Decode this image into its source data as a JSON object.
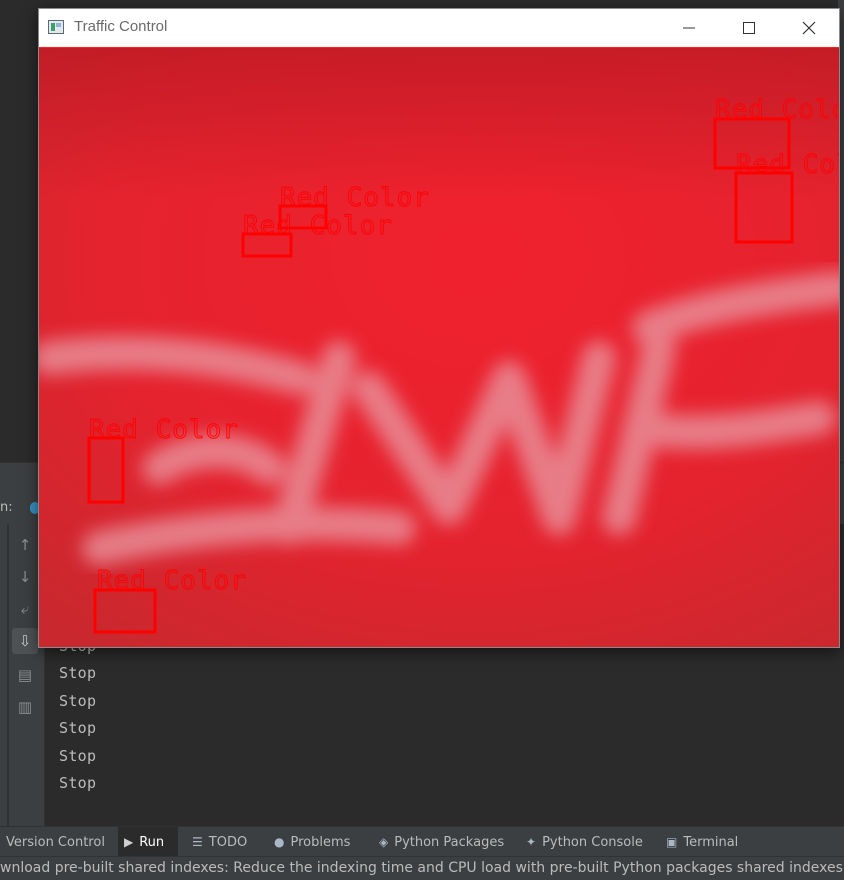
{
  "window": {
    "title": "Traffic Control",
    "controls": {
      "minimize": "—",
      "maximize": "☐",
      "close": "✕"
    }
  },
  "detections": [
    {
      "label": "Red Color"
    },
    {
      "label": "Red Color"
    },
    {
      "label": "Red Color"
    },
    {
      "label": "Red Color"
    },
    {
      "label": "Red Color"
    },
    {
      "label": "Red Color"
    }
  ],
  "run_panel": {
    "label": "n:",
    "console_lines": [
      "Stop",
      "Stop",
      "Stop",
      "Stop",
      "Stop",
      "Stop"
    ]
  },
  "tool_windows": [
    {
      "label": "Version Control",
      "icon": "version-control-icon",
      "active": false
    },
    {
      "label": "Run",
      "icon": "run-icon",
      "active": true
    },
    {
      "label": "TODO",
      "icon": "todo-icon",
      "active": false
    },
    {
      "label": "Problems",
      "icon": "problems-icon",
      "active": false
    },
    {
      "label": "Python Packages",
      "icon": "python-packages-icon",
      "active": false
    },
    {
      "label": "Python Console",
      "icon": "python-console-icon",
      "active": false
    },
    {
      "label": "Terminal",
      "icon": "terminal-icon",
      "active": false
    }
  ],
  "status_bar": {
    "message": "wnload pre-built shared indexes: Reduce the indexing time and CPU load with pre-built Python packages shared indexes // Alwa"
  },
  "colors": {
    "detection": "#ff0000",
    "frame_background": "#e8202a",
    "ide_background": "#2b2b2b",
    "panel": "#3c3f41"
  }
}
